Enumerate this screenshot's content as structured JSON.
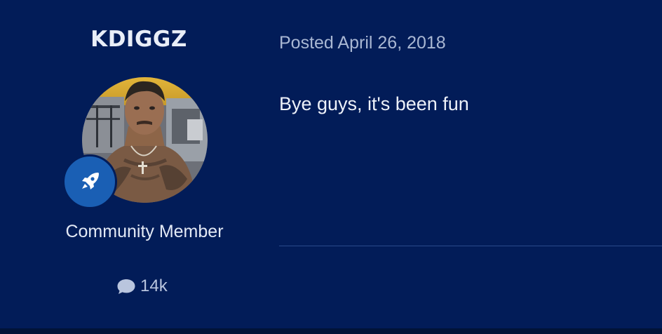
{
  "author": {
    "username": "KDIGGZ",
    "member_title": "Community Member",
    "badge_icon": "rocket-icon",
    "post_count": "14k",
    "stats_icon": "speech-bubble-icon"
  },
  "post": {
    "posted_prefix": "Posted",
    "posted_date": "April 26, 2018",
    "body": "Bye guys, it's been fun"
  },
  "colors": {
    "background": "#021c58",
    "badge": "#1a5fb4",
    "divider": "#2a4a8a"
  }
}
